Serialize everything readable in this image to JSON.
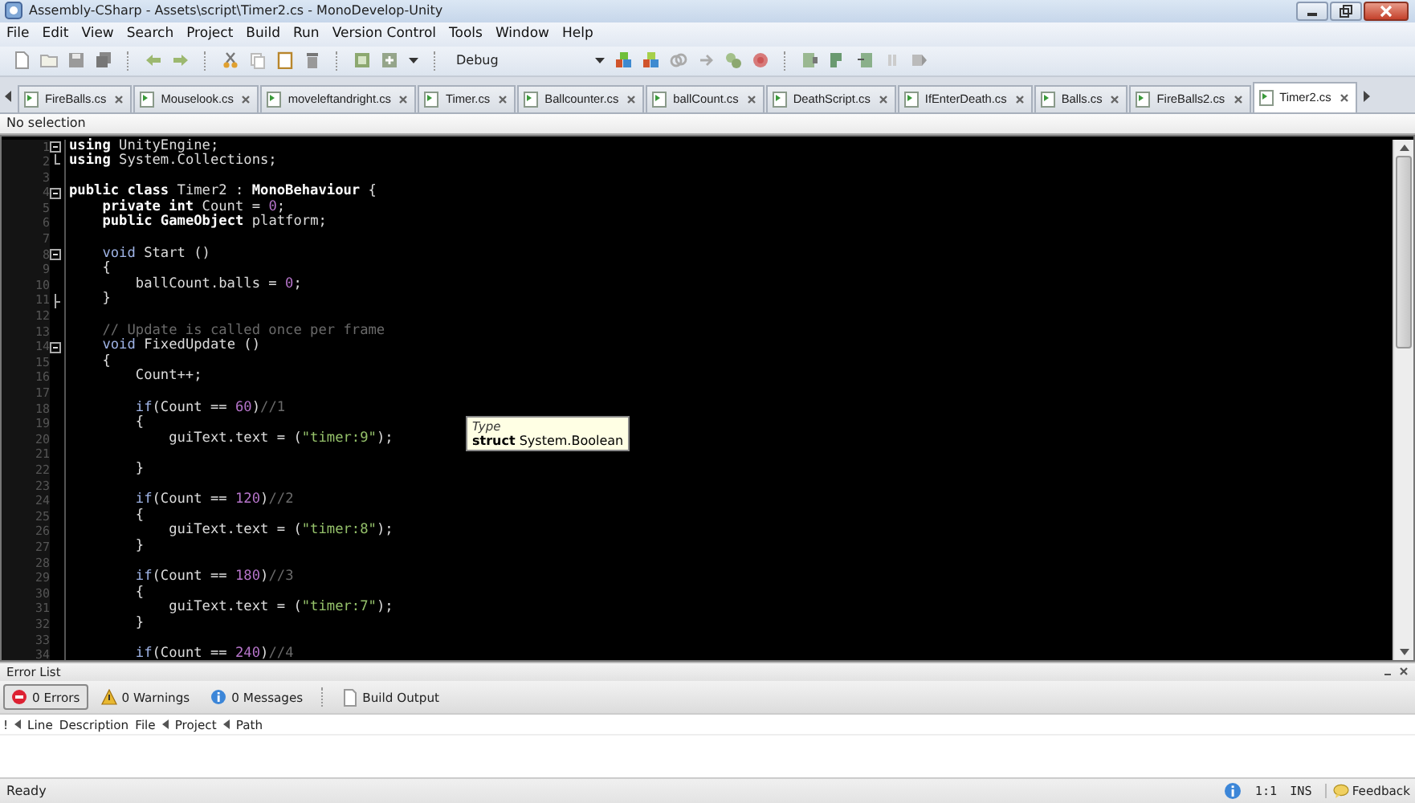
{
  "window": {
    "title": "Assembly-CSharp - Assets\\script\\Timer2.cs - MonoDevelop-Unity"
  },
  "menu": [
    "File",
    "Edit",
    "View",
    "Search",
    "Project",
    "Build",
    "Run",
    "Version Control",
    "Tools",
    "Window",
    "Help"
  ],
  "toolbar": {
    "configuration": "Debug"
  },
  "tabs": [
    {
      "label": "FireBalls.cs",
      "selected": false
    },
    {
      "label": "Mouselook.cs",
      "selected": false
    },
    {
      "label": "moveleftandright.cs",
      "selected": false
    },
    {
      "label": "Timer.cs",
      "selected": false
    },
    {
      "label": "Ballcounter.cs",
      "selected": false
    },
    {
      "label": "ballCount.cs",
      "selected": false
    },
    {
      "label": "DeathScript.cs",
      "selected": false
    },
    {
      "label": "IfEnterDeath.cs",
      "selected": false
    },
    {
      "label": "Balls.cs",
      "selected": false
    },
    {
      "label": "FireBalls2.cs",
      "selected": false
    },
    {
      "label": "Timer2.cs",
      "selected": true
    }
  ],
  "path_bar": "No selection",
  "editor": {
    "lines": [
      {
        "number": "1",
        "kind": "fold_open",
        "tokens": [
          {
            "text": "using",
            "kind": "keyword"
          },
          {
            "text": " UnityEngine;",
            "kind": "plain"
          }
        ]
      },
      {
        "number": "2",
        "kind": "fold_end",
        "tokens": [
          {
            "text": "using",
            "kind": "keyword"
          },
          {
            "text": " System.Collections;",
            "kind": "plain"
          }
        ]
      },
      {
        "number": "3",
        "kind": "plain"
      },
      {
        "number": "4",
        "kind": "fold_open",
        "tokens": [
          {
            "text": "public class",
            "kind": "keyword"
          },
          {
            "text": " Timer2 : ",
            "kind": "plain"
          },
          {
            "text": "MonoBehaviour",
            "kind": "type"
          },
          {
            "text": " {",
            "kind": "plain"
          }
        ]
      },
      {
        "number": "5",
        "kind": "plain",
        "tokens": [
          {
            "text": "    private int",
            "kind": "keyword"
          },
          {
            "text": " Count = ",
            "kind": "plain"
          },
          {
            "text": "0",
            "kind": "number"
          },
          {
            "text": ";",
            "kind": "plain"
          }
        ]
      },
      {
        "number": "6",
        "kind": "plain",
        "tokens": [
          {
            "text": "    public ",
            "kind": "keyword"
          },
          {
            "text": "GameObject",
            "kind": "type"
          },
          {
            "text": " platform;",
            "kind": "plain"
          }
        ]
      },
      {
        "number": "7",
        "kind": "plain"
      },
      {
        "number": "8",
        "kind": "fold_open",
        "tokens": [
          {
            "text": "    void",
            "kind": "control"
          },
          {
            "text": " Start ()",
            "kind": "plain"
          }
        ]
      },
      {
        "number": "9",
        "kind": "plain",
        "tokens": [
          {
            "text": "    {",
            "kind": "plain"
          }
        ]
      },
      {
        "number": "10",
        "kind": "plain",
        "tokens": [
          {
            "text": "        ballCount.balls = ",
            "kind": "plain"
          },
          {
            "text": "0",
            "kind": "number"
          },
          {
            "text": ";",
            "kind": "plain"
          }
        ]
      },
      {
        "number": "11",
        "kind": "fold_branch",
        "tokens": [
          {
            "text": "    }",
            "kind": "plain"
          }
        ]
      },
      {
        "number": "12",
        "kind": "plain"
      },
      {
        "number": "13",
        "kind": "plain",
        "tokens": [
          {
            "text": "    // Update is called once per frame",
            "kind": "comment"
          }
        ]
      },
      {
        "number": "14",
        "kind": "fold_open",
        "tokens": [
          {
            "text": "    void",
            "kind": "control"
          },
          {
            "text": " FixedUpdate ()",
            "kind": "plain"
          }
        ]
      },
      {
        "number": "15",
        "kind": "plain",
        "tokens": [
          {
            "text": "    {",
            "kind": "plain"
          }
        ]
      },
      {
        "number": "16",
        "kind": "plain",
        "tokens": [
          {
            "text": "        Count++;",
            "kind": "plain"
          }
        ]
      },
      {
        "number": "17",
        "kind": "plain"
      },
      {
        "number": "18",
        "kind": "plain",
        "tokens": [
          {
            "text": "        if",
            "kind": "control"
          },
          {
            "text": "(Count == ",
            "kind": "plain"
          },
          {
            "text": "60",
            "kind": "number"
          },
          {
            "text": ")",
            "kind": "plain"
          },
          {
            "text": "//1",
            "kind": "comment"
          }
        ]
      },
      {
        "number": "19",
        "kind": "plain",
        "tokens": [
          {
            "text": "        {",
            "kind": "plain"
          }
        ]
      },
      {
        "number": "20",
        "kind": "plain",
        "tokens": [
          {
            "text": "            guiText.text = (",
            "kind": "plain"
          },
          {
            "text": "\"timer:9\"",
            "kind": "string"
          },
          {
            "text": ");",
            "kind": "plain"
          }
        ]
      },
      {
        "number": "21",
        "kind": "plain"
      },
      {
        "number": "22",
        "kind": "plain",
        "tokens": [
          {
            "text": "        }",
            "kind": "plain"
          }
        ]
      },
      {
        "number": "23",
        "kind": "plain"
      },
      {
        "number": "24",
        "kind": "plain",
        "tokens": [
          {
            "text": "        if",
            "kind": "control"
          },
          {
            "text": "(Count == ",
            "kind": "plain"
          },
          {
            "text": "120",
            "kind": "number"
          },
          {
            "text": ")",
            "kind": "plain"
          },
          {
            "text": "//2",
            "kind": "comment"
          }
        ]
      },
      {
        "number": "25",
        "kind": "plain",
        "tokens": [
          {
            "text": "        {",
            "kind": "plain"
          }
        ]
      },
      {
        "number": "26",
        "kind": "plain",
        "tokens": [
          {
            "text": "            guiText.text = (",
            "kind": "plain"
          },
          {
            "text": "\"timer:8\"",
            "kind": "string"
          },
          {
            "text": ");",
            "kind": "plain"
          }
        ]
      },
      {
        "number": "27",
        "kind": "plain",
        "tokens": [
          {
            "text": "        }",
            "kind": "plain"
          }
        ]
      },
      {
        "number": "28",
        "kind": "plain"
      },
      {
        "number": "29",
        "kind": "plain",
        "tokens": [
          {
            "text": "        if",
            "kind": "control"
          },
          {
            "text": "(Count == ",
            "kind": "plain"
          },
          {
            "text": "180",
            "kind": "number"
          },
          {
            "text": ")",
            "kind": "plain"
          },
          {
            "text": "//3",
            "kind": "comment"
          }
        ]
      },
      {
        "number": "30",
        "kind": "plain",
        "tokens": [
          {
            "text": "        {",
            "kind": "plain"
          }
        ]
      },
      {
        "number": "31",
        "kind": "plain",
        "tokens": [
          {
            "text": "            guiText.text = (",
            "kind": "plain"
          },
          {
            "text": "\"timer:7\"",
            "kind": "string"
          },
          {
            "text": ");",
            "kind": "plain"
          }
        ]
      },
      {
        "number": "32",
        "kind": "plain",
        "tokens": [
          {
            "text": "        }",
            "kind": "plain"
          }
        ]
      },
      {
        "number": "33",
        "kind": "plain"
      },
      {
        "number": "34",
        "kind": "plain",
        "tokens": [
          {
            "text": "        if",
            "kind": "control"
          },
          {
            "text": "(Count == ",
            "kind": "plain"
          },
          {
            "text": "240",
            "kind": "number"
          },
          {
            "text": ")",
            "kind": "plain"
          },
          {
            "text": "//4",
            "kind": "comment"
          }
        ]
      }
    ],
    "tooltip": {
      "heading": "Type",
      "text": "**struct** System.Boolean"
    }
  },
  "error_list": {
    "title": "Error List",
    "filters": [
      {
        "kind": "error",
        "label": "0 Errors",
        "selected": true
      },
      {
        "kind": "warning",
        "label": "0 Warnings",
        "selected": false
      },
      {
        "kind": "message",
        "label": "0 Messages",
        "selected": false
      }
    ],
    "build_output": "Build Output",
    "columns": [
      "!",
      "Line",
      "Description",
      "File",
      "Project",
      "Path"
    ]
  },
  "status_bar": {
    "text": "Ready",
    "position": "1:1",
    "mode": "INS",
    "feedback": "Feedback"
  }
}
